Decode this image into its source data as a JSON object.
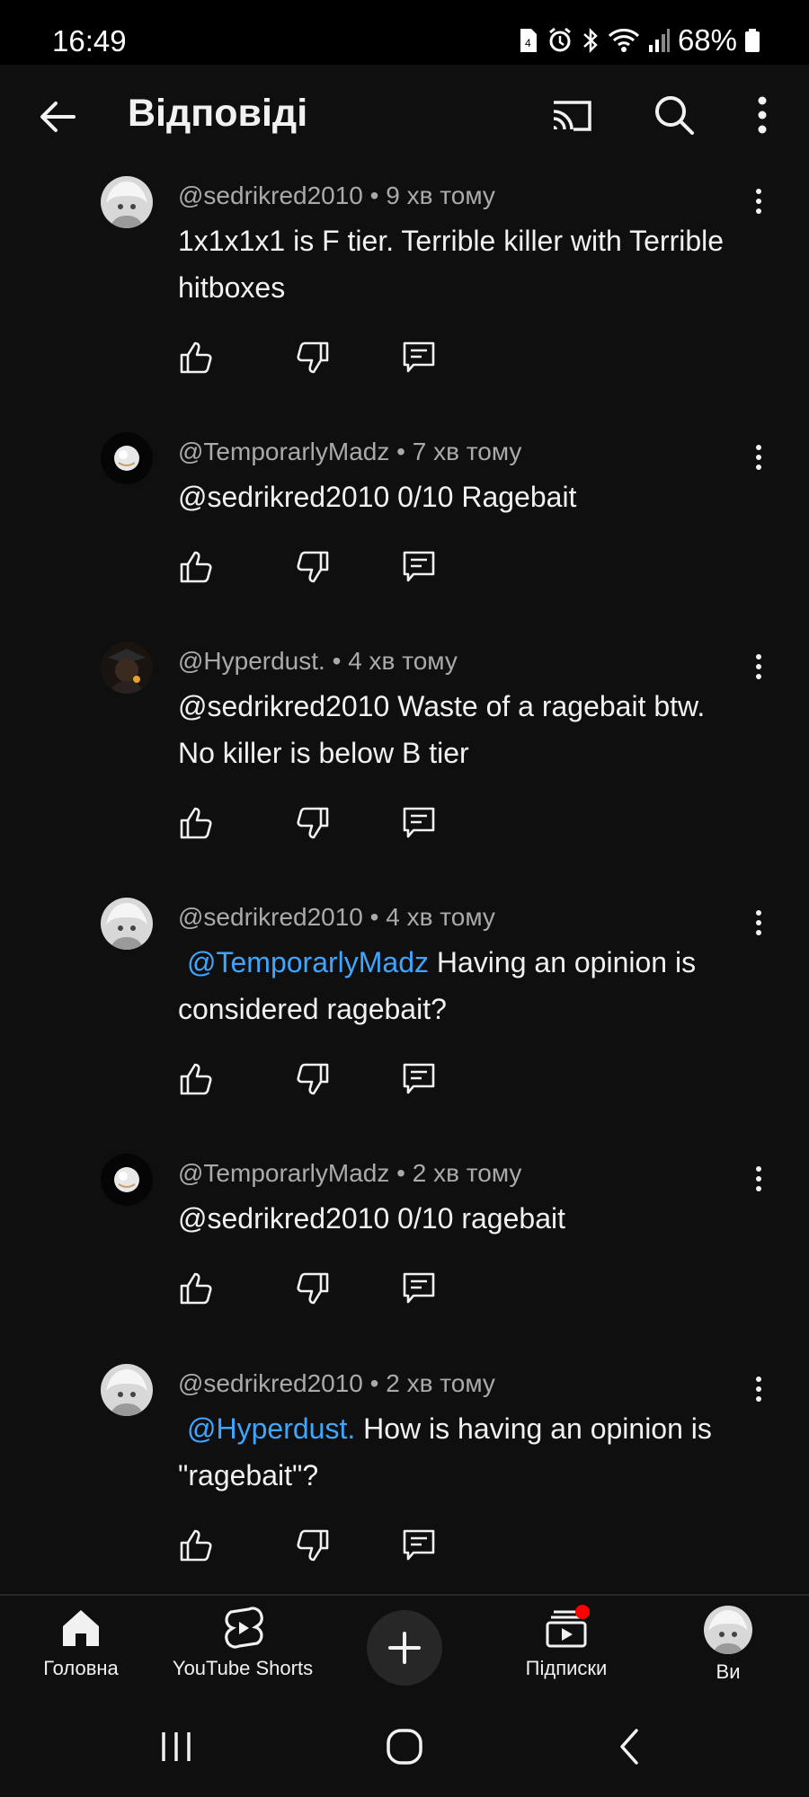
{
  "status_bar": {
    "time": "16:49",
    "battery": "68%",
    "icons": [
      "sim-icon",
      "alarm-icon",
      "bluetooth-icon",
      "wifi-icon",
      "signal-icon",
      "battery-icon"
    ]
  },
  "header": {
    "title": "Відповіді",
    "icons": [
      "back-arrow-icon",
      "cast-icon",
      "search-icon",
      "more-vert-icon"
    ]
  },
  "comments": [
    {
      "author": "@sedrikred2010",
      "time": "9 хв тому",
      "mention": "",
      "text": "1x1x1x1 is F tier. Terrible killer with Terrible hitboxes"
    },
    {
      "author": "@TemporarlyMadz",
      "time": "7 хв тому",
      "mention": "",
      "text": "@sedrikred2010 0/10 Ragebait"
    },
    {
      "author": "@Hyperdust.",
      "time": "4 хв тому",
      "mention": "",
      "text": "@sedrikred2010 Waste of a ragebait btw. No killer is below B tier"
    },
    {
      "author": "@sedrikred2010",
      "time": "4 хв тому",
      "mention": "@TemporarlyMadz",
      "text": "Having an opinion is considered ragebait?"
    },
    {
      "author": "@TemporarlyMadz",
      "time": "2 хв тому",
      "mention": "",
      "text": "@sedrikred2010 0/10 ragebait"
    },
    {
      "author": "@sedrikred2010",
      "time": "2 хв тому",
      "mention": "@Hyperdust.",
      "text": "How is having an opinion is \"ragebait\"?"
    }
  ],
  "meta_separator": " • ",
  "bottom_nav": {
    "items": [
      {
        "label": "Головна",
        "icon": "home-icon"
      },
      {
        "label": "YouTube Shorts",
        "icon": "shorts-icon"
      },
      {
        "label": "",
        "icon": "create-plus-icon"
      },
      {
        "label": "Підписки",
        "icon": "subscriptions-icon"
      },
      {
        "label": "Ви",
        "icon": "avatar"
      }
    ]
  },
  "colors": {
    "background": "#0f0f0f",
    "text": "#f1f1f1",
    "meta": "#aaaaaa",
    "mention": "#3ea6ff",
    "notification_dot": "#ff0000"
  }
}
